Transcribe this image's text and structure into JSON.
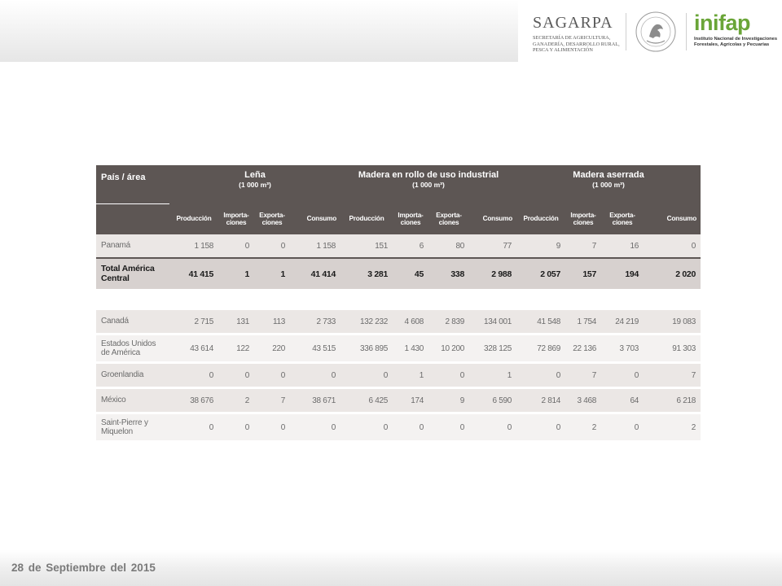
{
  "header": {
    "sagarpa_title": "SAGARPA",
    "sagarpa_subtitle": [
      "SECRETARÍA DE AGRICULTURA,",
      "GANADERÍA, DESARROLLO RURAL,",
      "PESCA Y ALIMENTACIÓN"
    ],
    "inifap_title": "inifap",
    "inifap_subtitle": [
      "Instituto Nacional de Investigaciones",
      "Forestales, Agrícolas y Pecuarias"
    ],
    "seal_label": "ESTADOS UNIDOS MEXICANOS"
  },
  "table": {
    "country_header": "País / área",
    "groups": [
      {
        "title": "Leña",
        "unit": "(1 000 m³)"
      },
      {
        "title": "Madera en rollo de uso industrial",
        "unit": "(1 000 m³)"
      },
      {
        "title": "Madera aserrada",
        "unit": "(1 000 m³)"
      }
    ],
    "subheaders": [
      [
        "Producción",
        "Importa-",
        "ciones",
        "Exporta-",
        "ciones",
        "Consumo"
      ],
      [
        "Producción",
        "Importa-",
        "ciones",
        "Exporta-",
        "ciones",
        "Consumo"
      ],
      [
        "Producción",
        "Importa-",
        "ciones",
        "Exporta-",
        "ciones",
        "Consumo"
      ]
    ],
    "rows_central": [
      {
        "name": "Panamá",
        "values": [
          "1 158",
          "0",
          "0",
          "1 158",
          "151",
          "6",
          "80",
          "77",
          "9",
          "7",
          "16",
          "0"
        ]
      }
    ],
    "total": {
      "name_line1": "Total América",
      "name_line2": "Central",
      "values": [
        "41 415",
        "1",
        "1",
        "41 414",
        "3 281",
        "45",
        "338",
        "2 988",
        "2 057",
        "157",
        "194",
        "2 020"
      ]
    },
    "rows_north": [
      {
        "name_line1": "Canadá",
        "name_line2": "",
        "values": [
          "2 715",
          "131",
          "113",
          "2 733",
          "132 232",
          "4 608",
          "2 839",
          "134 001",
          "41 548",
          "1 754",
          "24 219",
          "19 083"
        ]
      },
      {
        "name_line1": "Estados Unidos",
        "name_line2": "de América",
        "values": [
          "43 614",
          "122",
          "220",
          "43 515",
          "336 895",
          "1 430",
          "10 200",
          "328 125",
          "72 869",
          "22 136",
          "3 703",
          "91 303"
        ]
      },
      {
        "name_line1": "Groenlandia",
        "name_line2": "",
        "values": [
          "0",
          "0",
          "0",
          "0",
          "0",
          "1",
          "0",
          "1",
          "0",
          "7",
          "0",
          "7"
        ]
      },
      {
        "name_line1": "México",
        "name_line2": "",
        "values": [
          "38 676",
          "2",
          "7",
          "38 671",
          "6 425",
          "174",
          "9",
          "6 590",
          "2 814",
          "3 468",
          "64",
          "6 218"
        ]
      },
      {
        "name_line1": "Saint-Pierre y",
        "name_line2": "Miquelon",
        "values": [
          "0",
          "0",
          "0",
          "0",
          "0",
          "0",
          "0",
          "0",
          "0",
          "2",
          "0",
          "2"
        ]
      }
    ]
  },
  "footer": {
    "date": "28 de Septiembre  del  2015"
  },
  "colors": {
    "header_bg": "#5d5654",
    "row_light": "#ebe7e5",
    "row_total": "#d7d1cf",
    "inifap_green": "#6aa538"
  }
}
